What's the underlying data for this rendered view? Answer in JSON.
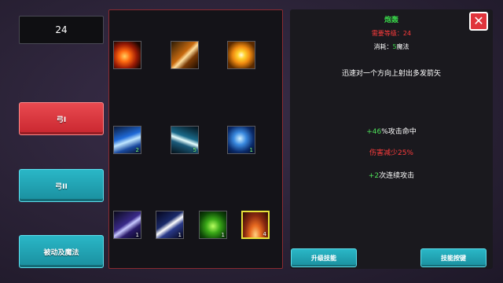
{
  "skill_points": "24",
  "tabs": [
    {
      "label": "弓I"
    },
    {
      "label": "弓II"
    },
    {
      "label": "被动及魔法"
    }
  ],
  "skills": [
    {
      "icon": "fire-arrow-icon",
      "level": ""
    },
    {
      "icon": "arrow-strike-icon",
      "level": ""
    },
    {
      "icon": "explosion-icon",
      "level": ""
    },
    {
      "icon": "ice-arrow-icon",
      "level": "2"
    },
    {
      "icon": "multi-arrow-icon",
      "level": "5"
    },
    {
      "icon": "frost-shot-icon",
      "level": "1"
    },
    {
      "icon": "arrow-icon",
      "level": "1"
    },
    {
      "icon": "piercing-arrow-icon",
      "level": "1"
    },
    {
      "icon": "poison-bow-icon",
      "level": "1"
    },
    {
      "icon": "arrow-burst-icon",
      "level": "4"
    }
  ],
  "detail": {
    "name": "炮轰",
    "requirement": "需要等级：24",
    "cost_prefix": "消耗：",
    "cost_value": "5",
    "cost_suffix": "魔法",
    "description": "迅速对一个方向上射出多发箭矢",
    "bonus1_value": "+46",
    "bonus1_text": "%攻击命中",
    "bonus2": "伤害减少25%",
    "bonus3_value": "+2",
    "bonus3_text": "次连续攻击"
  },
  "buttons": {
    "upgrade": "升级技能",
    "hotkey": "技能按键"
  },
  "colors": {
    "accent_red": "#e94a50",
    "accent_teal": "#2ab7c7",
    "text_green": "#39d84a",
    "text_red": "#ff3c3c",
    "selected_border": "#e8e23a"
  }
}
